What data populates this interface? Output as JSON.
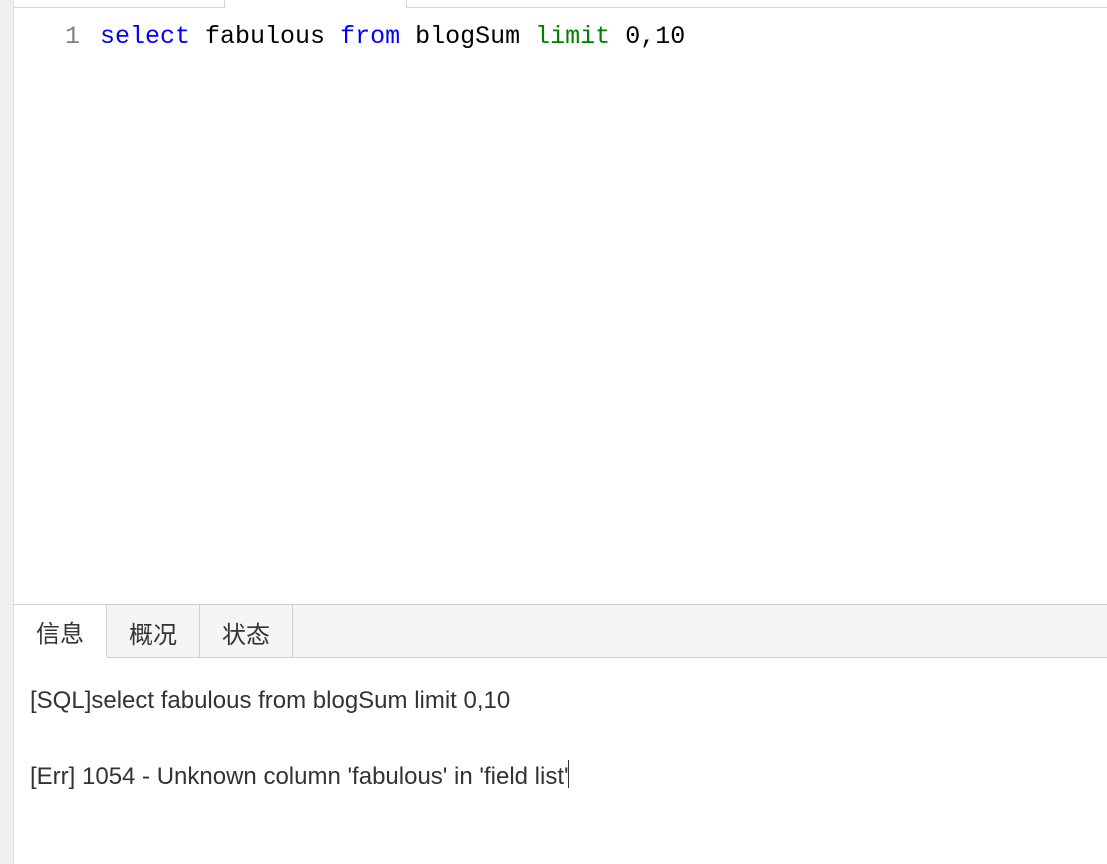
{
  "editor": {
    "line_number": "1",
    "code": {
      "select": "select",
      "col": "fabulous",
      "from": "from",
      "table": "blogSum",
      "limit": "limit",
      "args": "0,10"
    }
  },
  "tabs": {
    "info": "信息",
    "overview": "概况",
    "status": "状态"
  },
  "output": {
    "sql_line": "[SQL]select fabulous from blogSum limit 0,10",
    "err_line": "[Err] 1054 - Unknown column 'fabulous' in 'field list'"
  }
}
